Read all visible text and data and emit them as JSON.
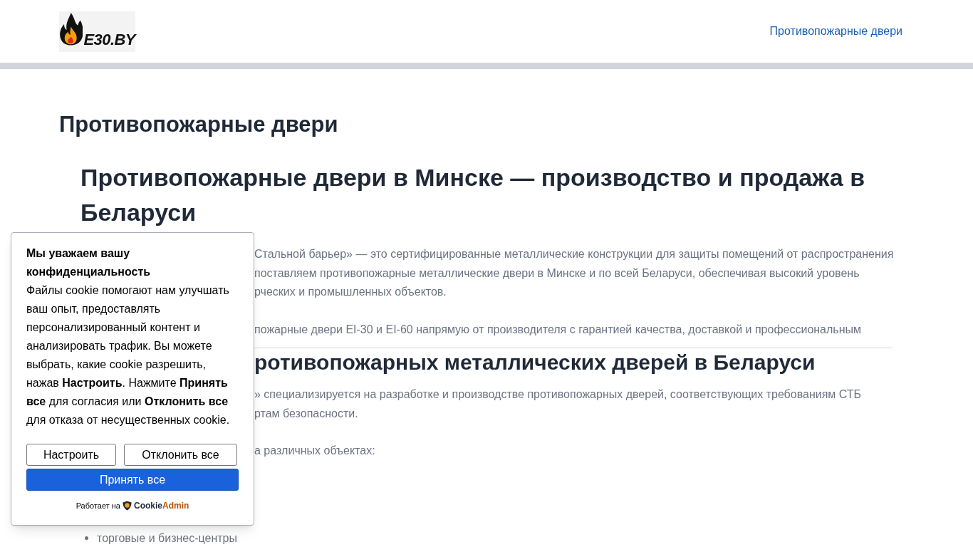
{
  "header": {
    "logo_text": "E30.BY",
    "nav": [
      {
        "label": "Противопожарные двери"
      }
    ]
  },
  "page_title": "Противопожарные двери",
  "article": {
    "heading": "Противопожарные двери в Минске — производство и продажа в Беларуси",
    "blocks": [
      {
        "kind": "text",
        "lines": [
          "Стальной барьер» — это сертифицированные металлические конструкции для защиты помещений от распространения",
          "поставляем противопожарные металлические двери в Минске и по всей Беларуси, обеспечивая высокий уровень",
          "рческих и промышленных объектов."
        ]
      },
      {
        "kind": "text",
        "lines": [
          "пожарные двери EI-30 и EI-60 напрямую от производителя с гарантией качества, доставкой и профессиональным"
        ]
      },
      {
        "kind": "heading",
        "text": "ротивопожарных металлических дверей в Беларуси"
      },
      {
        "kind": "text",
        "lines": [
          "» специализируется на разработке и производстве противопожарных дверей, соответствующих требованиям СТБ",
          "ртам безопасности."
        ]
      },
      {
        "kind": "text",
        "lines": [
          "а различных объектах:"
        ]
      },
      {
        "kind": "list",
        "items": [
          "торговые и бизнес-центры"
        ]
      }
    ]
  },
  "cookie_banner": {
    "title": "Мы уважаем вашу конфиденциальность",
    "body": "Файлы cookie помогают нам улучшать ваш опыт, предоставлять персонализированный контент и анализировать трафик. Вы можете выбрать, какие cookie разрешить, нажав **Настроить**. Нажмите **Принять все** для согласия или **Отклонить все** для отказа от несущественных cookie.",
    "buttons": [
      {
        "label": "Настроить",
        "kind": "outline"
      },
      {
        "label": "Отклонить все",
        "kind": "outline"
      },
      {
        "label": "Принять все",
        "kind": "primary"
      }
    ],
    "powered_by": "Работает на",
    "brand_parts": [
      "Cookie",
      "Admin"
    ]
  }
}
